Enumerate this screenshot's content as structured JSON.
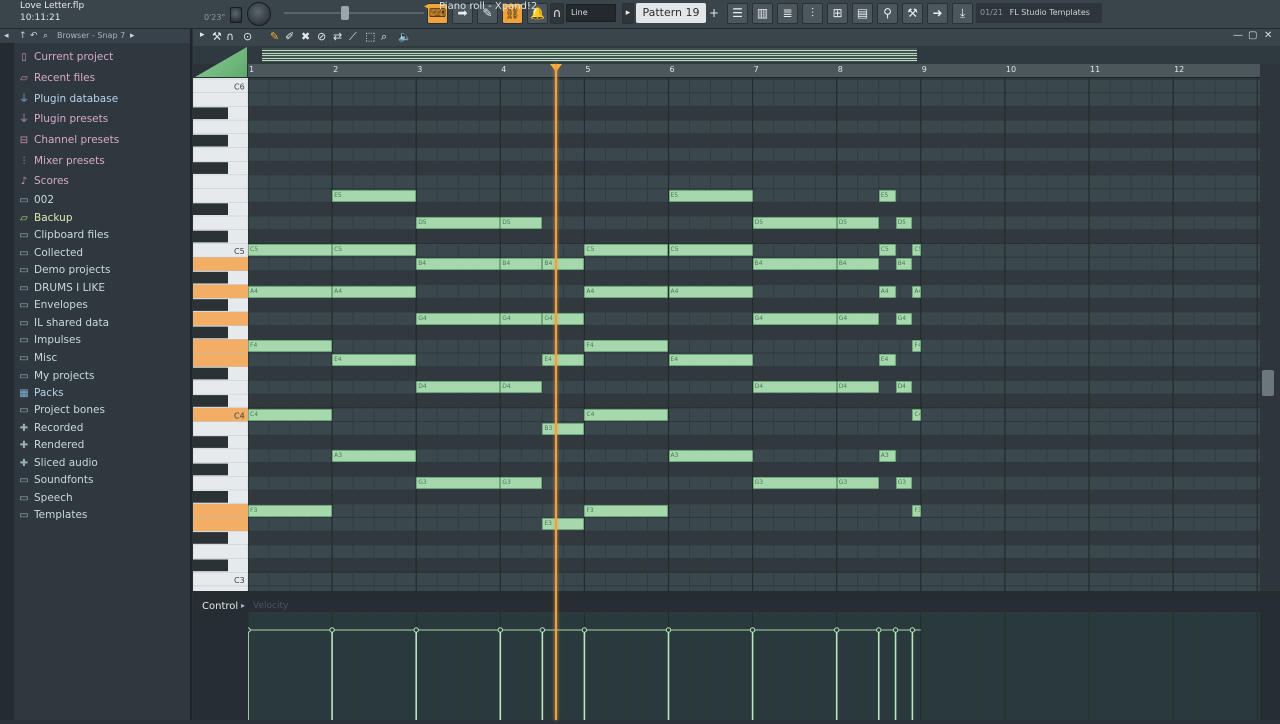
{
  "titlebar": {
    "file_name": "Love Letter.flp",
    "time": "10:11:21",
    "time_sig": "0'23\""
  },
  "toolbar": {
    "snap_value": "Line",
    "pattern": "Pattern 19",
    "pattern_add": "+",
    "hint_number": "01/21",
    "hint_text": "FL Studio Templates"
  },
  "browser": {
    "header_text": "Browser - Snap 7",
    "items": [
      {
        "label": "Current project",
        "icon": "document-icon",
        "style": "pink"
      },
      {
        "label": "Recent files",
        "icon": "recent-folder-icon",
        "style": "pink"
      },
      {
        "label": "Plugin database",
        "icon": "plug-icon",
        "style": "blue"
      },
      {
        "label": "Plugin presets",
        "icon": "plug-icon",
        "style": "pink"
      },
      {
        "label": "Channel presets",
        "icon": "channel-icon",
        "style": "pink"
      },
      {
        "label": "Mixer presets",
        "icon": "mixer-icon",
        "style": "pink"
      },
      {
        "label": "Scores",
        "icon": "note-icon",
        "style": "pink"
      },
      {
        "label": "002",
        "icon": "folder-icon",
        "style": "folder"
      },
      {
        "label": "Backup",
        "icon": "folder-open-icon",
        "style": "green"
      },
      {
        "label": "Clipboard files",
        "icon": "folder-icon",
        "style": "folder"
      },
      {
        "label": "Collected",
        "icon": "folder-icon",
        "style": "folder"
      },
      {
        "label": "Demo projects",
        "icon": "folder-icon",
        "style": "folder"
      },
      {
        "label": "DRUMS I LIKE",
        "icon": "folder-icon",
        "style": "folder"
      },
      {
        "label": "Envelopes",
        "icon": "folder-icon",
        "style": "folder"
      },
      {
        "label": "IL shared data",
        "icon": "folder-icon",
        "style": "folder"
      },
      {
        "label": "Impulses",
        "icon": "folder-icon",
        "style": "folder"
      },
      {
        "label": "Misc",
        "icon": "folder-icon",
        "style": "folder"
      },
      {
        "label": "My projects",
        "icon": "folder-icon",
        "style": "folder"
      },
      {
        "label": "Packs",
        "icon": "packs-icon",
        "style": "blue"
      },
      {
        "label": "Project bones",
        "icon": "folder-icon",
        "style": "folder"
      },
      {
        "label": "Recorded",
        "icon": "record-icon",
        "style": "folder"
      },
      {
        "label": "Rendered",
        "icon": "render-icon",
        "style": "folder"
      },
      {
        "label": "Sliced audio",
        "icon": "slice-icon",
        "style": "folder"
      },
      {
        "label": "Soundfonts",
        "icon": "folder-icon",
        "style": "folder"
      },
      {
        "label": "Speech",
        "icon": "folder-icon",
        "style": "folder"
      },
      {
        "label": "Templates",
        "icon": "folder-icon",
        "style": "folder"
      }
    ]
  },
  "piano_roll": {
    "title": "Piano roll - Xpand!2",
    "ruler_bars": [
      "1",
      "2",
      "3",
      "4",
      "5",
      "6",
      "7",
      "8",
      "9",
      "10",
      "11",
      "12"
    ],
    "key_labels": [
      "C6",
      "C5",
      "C4",
      "C3"
    ],
    "playhead_bar": 4.6,
    "control_label": "Control",
    "velocity_label": "Velocity"
  },
  "notes": [
    {
      "pitch": "E5",
      "start": 2,
      "len": 1
    },
    {
      "pitch": "E5",
      "start": 6,
      "len": 1
    },
    {
      "pitch": "E5",
      "start": 8.5,
      "len": 0.2
    },
    {
      "pitch": "D5",
      "start": 3,
      "len": 1
    },
    {
      "pitch": "D5",
      "start": 4,
      "len": 0.5
    },
    {
      "pitch": "D5",
      "start": 7,
      "len": 1
    },
    {
      "pitch": "D5",
      "start": 8,
      "len": 0.5
    },
    {
      "pitch": "D5",
      "start": 8.7,
      "len": 0.2
    },
    {
      "pitch": "C5",
      "start": 1,
      "len": 1
    },
    {
      "pitch": "C5",
      "start": 2,
      "len": 1
    },
    {
      "pitch": "C5",
      "start": 5,
      "len": 1
    },
    {
      "pitch": "C5",
      "start": 6,
      "len": 1
    },
    {
      "pitch": "C5",
      "start": 8.5,
      "len": 0.2
    },
    {
      "pitch": "C5",
      "start": 8.9,
      "len": 0.1
    },
    {
      "pitch": "B4",
      "start": 3,
      "len": 1
    },
    {
      "pitch": "B4",
      "start": 4,
      "len": 0.5
    },
    {
      "pitch": "B4",
      "start": 4.5,
      "len": 0.5
    },
    {
      "pitch": "B4",
      "start": 7,
      "len": 1
    },
    {
      "pitch": "B4",
      "start": 8,
      "len": 0.5
    },
    {
      "pitch": "B4",
      "start": 8.7,
      "len": 0.2
    },
    {
      "pitch": "A4",
      "start": 1,
      "len": 1
    },
    {
      "pitch": "A4",
      "start": 2,
      "len": 1
    },
    {
      "pitch": "A4",
      "start": 5,
      "len": 1
    },
    {
      "pitch": "A4",
      "start": 6,
      "len": 1
    },
    {
      "pitch": "A4",
      "start": 8.5,
      "len": 0.2
    },
    {
      "pitch": "A4",
      "start": 8.9,
      "len": 0.1
    },
    {
      "pitch": "G4",
      "start": 3,
      "len": 1
    },
    {
      "pitch": "G4",
      "start": 4,
      "len": 0.5
    },
    {
      "pitch": "G4",
      "start": 4.5,
      "len": 0.5
    },
    {
      "pitch": "G4",
      "start": 7,
      "len": 1
    },
    {
      "pitch": "G4",
      "start": 8,
      "len": 0.5
    },
    {
      "pitch": "G4",
      "start": 8.7,
      "len": 0.2
    },
    {
      "pitch": "F4",
      "start": 1,
      "len": 1
    },
    {
      "pitch": "F4",
      "start": 5,
      "len": 1
    },
    {
      "pitch": "F4",
      "start": 8.9,
      "len": 0.1
    },
    {
      "pitch": "E4",
      "start": 2,
      "len": 1
    },
    {
      "pitch": "E4",
      "start": 4.5,
      "len": 0.5
    },
    {
      "pitch": "E4",
      "start": 6,
      "len": 1
    },
    {
      "pitch": "E4",
      "start": 8.5,
      "len": 0.2
    },
    {
      "pitch": "D4",
      "start": 3,
      "len": 1
    },
    {
      "pitch": "D4",
      "start": 4,
      "len": 0.5
    },
    {
      "pitch": "D4",
      "start": 7,
      "len": 1
    },
    {
      "pitch": "D4",
      "start": 8,
      "len": 0.5
    },
    {
      "pitch": "D4",
      "start": 8.7,
      "len": 0.2
    },
    {
      "pitch": "C4",
      "start": 1,
      "len": 1
    },
    {
      "pitch": "C4",
      "start": 5,
      "len": 1
    },
    {
      "pitch": "C4",
      "start": 8.9,
      "len": 0.1
    },
    {
      "pitch": "B3",
      "start": 4.5,
      "len": 0.5
    },
    {
      "pitch": "A3",
      "start": 2,
      "len": 1
    },
    {
      "pitch": "A3",
      "start": 6,
      "len": 1
    },
    {
      "pitch": "A3",
      "start": 8.5,
      "len": 0.2
    },
    {
      "pitch": "G3",
      "start": 3,
      "len": 1
    },
    {
      "pitch": "G3",
      "start": 4,
      "len": 0.5
    },
    {
      "pitch": "G3",
      "start": 7,
      "len": 1
    },
    {
      "pitch": "G3",
      "start": 8,
      "len": 0.5
    },
    {
      "pitch": "G3",
      "start": 8.7,
      "len": 0.2
    },
    {
      "pitch": "F3",
      "start": 1,
      "len": 1
    },
    {
      "pitch": "F3",
      "start": 5,
      "len": 1
    },
    {
      "pitch": "F3",
      "start": 8.9,
      "len": 0.1
    },
    {
      "pitch": "E3",
      "start": 4.5,
      "len": 0.5
    }
  ],
  "colors": {
    "accent": "#f0a33b",
    "note": "#a6d7ad",
    "grid_bg": "#37444a",
    "playhead": "#f0a040"
  }
}
